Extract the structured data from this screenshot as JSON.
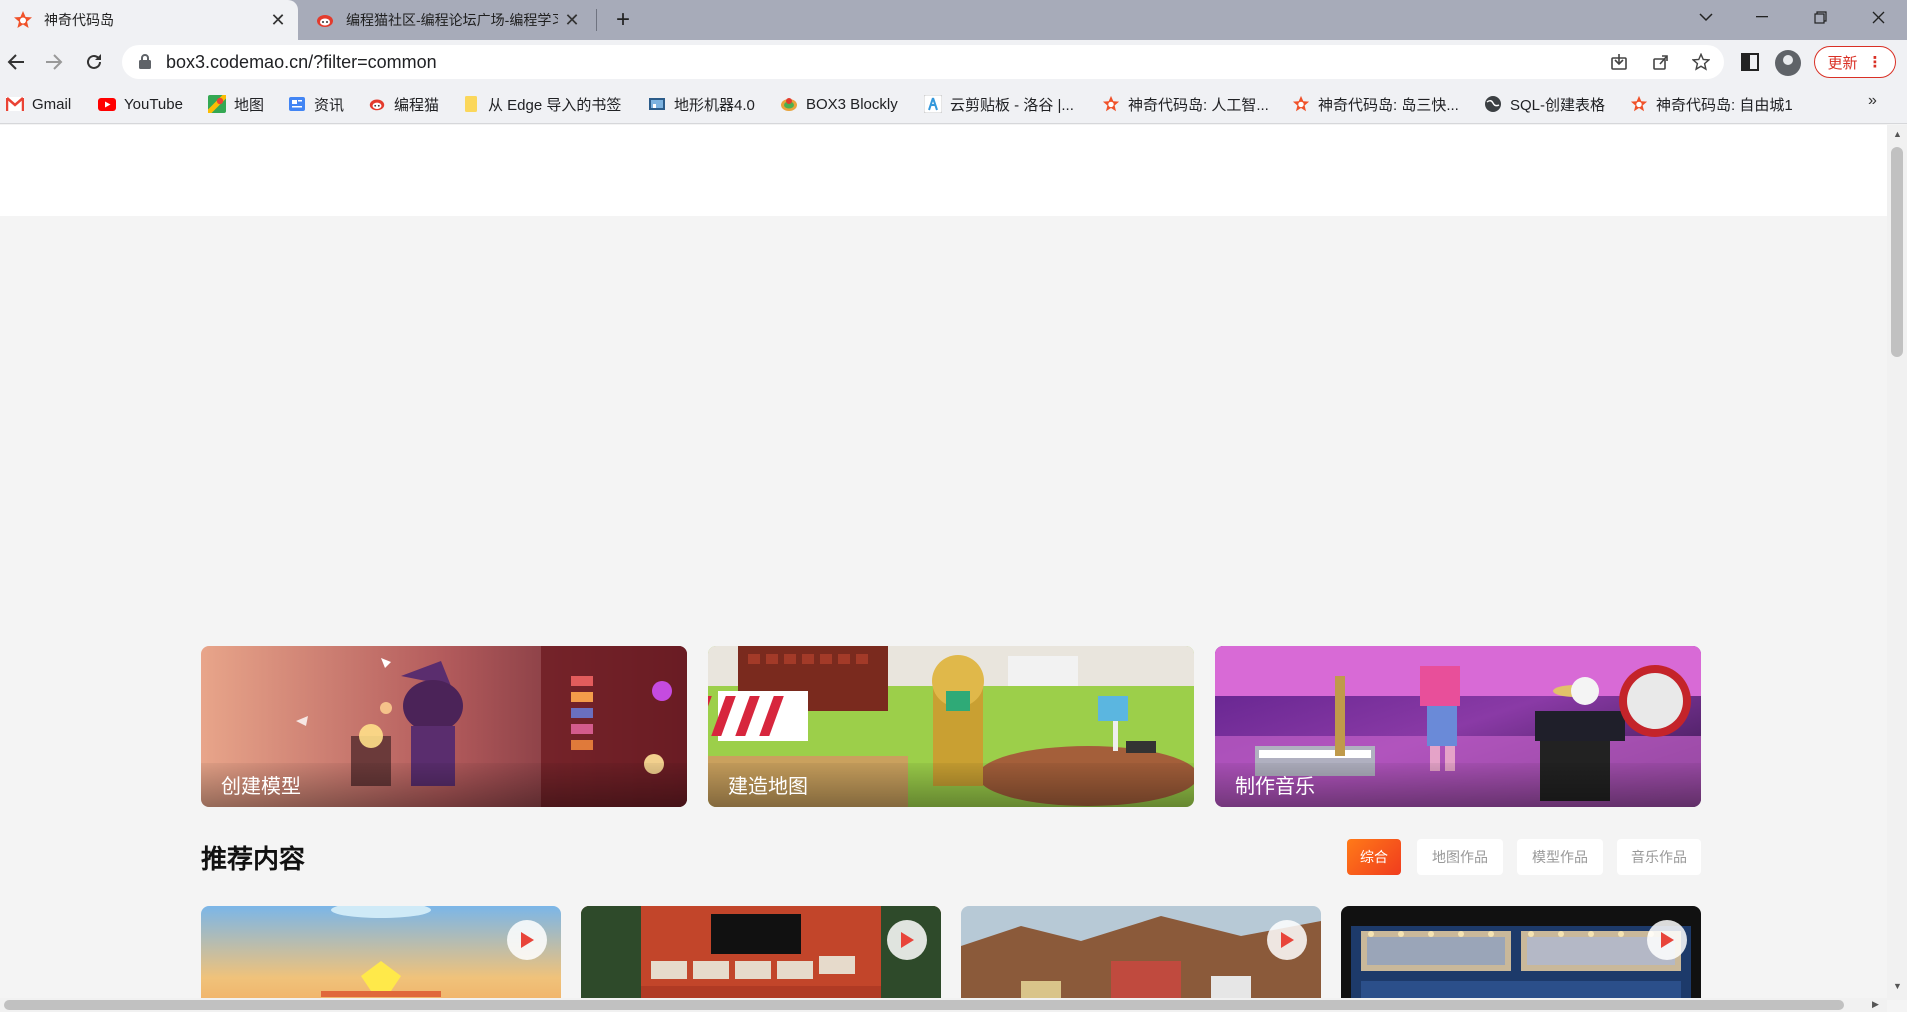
{
  "browser": {
    "tabs": [
      {
        "title": "神奇代码岛",
        "active": true,
        "favicon": "codemao-star-icon"
      },
      {
        "title": "编程猫社区-编程论坛广场-编程学习交流社区",
        "active": false,
        "favicon": "codemao-cat-icon"
      }
    ],
    "new_tab_label": "+",
    "address": {
      "url": "box3.codemao.cn/?filter=common"
    },
    "update_label": "更新",
    "bookmarks": [
      {
        "label": "Gmail",
        "icon": "gmail-icon"
      },
      {
        "label": "YouTube",
        "icon": "youtube-icon"
      },
      {
        "label": "地图",
        "icon": "maps-icon"
      },
      {
        "label": "资讯",
        "icon": "news-icon"
      },
      {
        "label": "编程猫",
        "icon": "codemao-cat-icon"
      },
      {
        "label": "从 Edge 导入的书签",
        "icon": "folder-icon"
      },
      {
        "label": "地形机器4.0",
        "icon": "terrain-icon"
      },
      {
        "label": "BOX3 Blockly",
        "icon": "blockly-icon"
      },
      {
        "label": "云剪贴板 - 洛谷 |...",
        "icon": "luogu-icon"
      },
      {
        "label": "神奇代码岛: 人工智...",
        "icon": "codemao-star-icon"
      },
      {
        "label": "神奇代码岛: 岛三快...",
        "icon": "codemao-star-icon"
      },
      {
        "label": "SQL-创建表格",
        "icon": "globe-icon"
      },
      {
        "label": "神奇代码岛: 自由城1",
        "icon": "codemao-star-icon"
      }
    ],
    "more_bookmarks": "»"
  },
  "page": {
    "features": [
      {
        "label": "创建模型"
      },
      {
        "label": "建造地图"
      },
      {
        "label": "制作音乐"
      }
    ],
    "section_title": "推荐内容",
    "filters": [
      {
        "label": "综合",
        "active": true
      },
      {
        "label": "地图作品",
        "active": false
      },
      {
        "label": "模型作品",
        "active": false
      },
      {
        "label": "音乐作品",
        "active": false
      }
    ],
    "works_count_visible": 4
  },
  "colors": {
    "accent": "#f5511e",
    "tabbar": "#a7abb9",
    "toolbar": "#f0f1f4",
    "page_bg": "#f4f4f4"
  }
}
